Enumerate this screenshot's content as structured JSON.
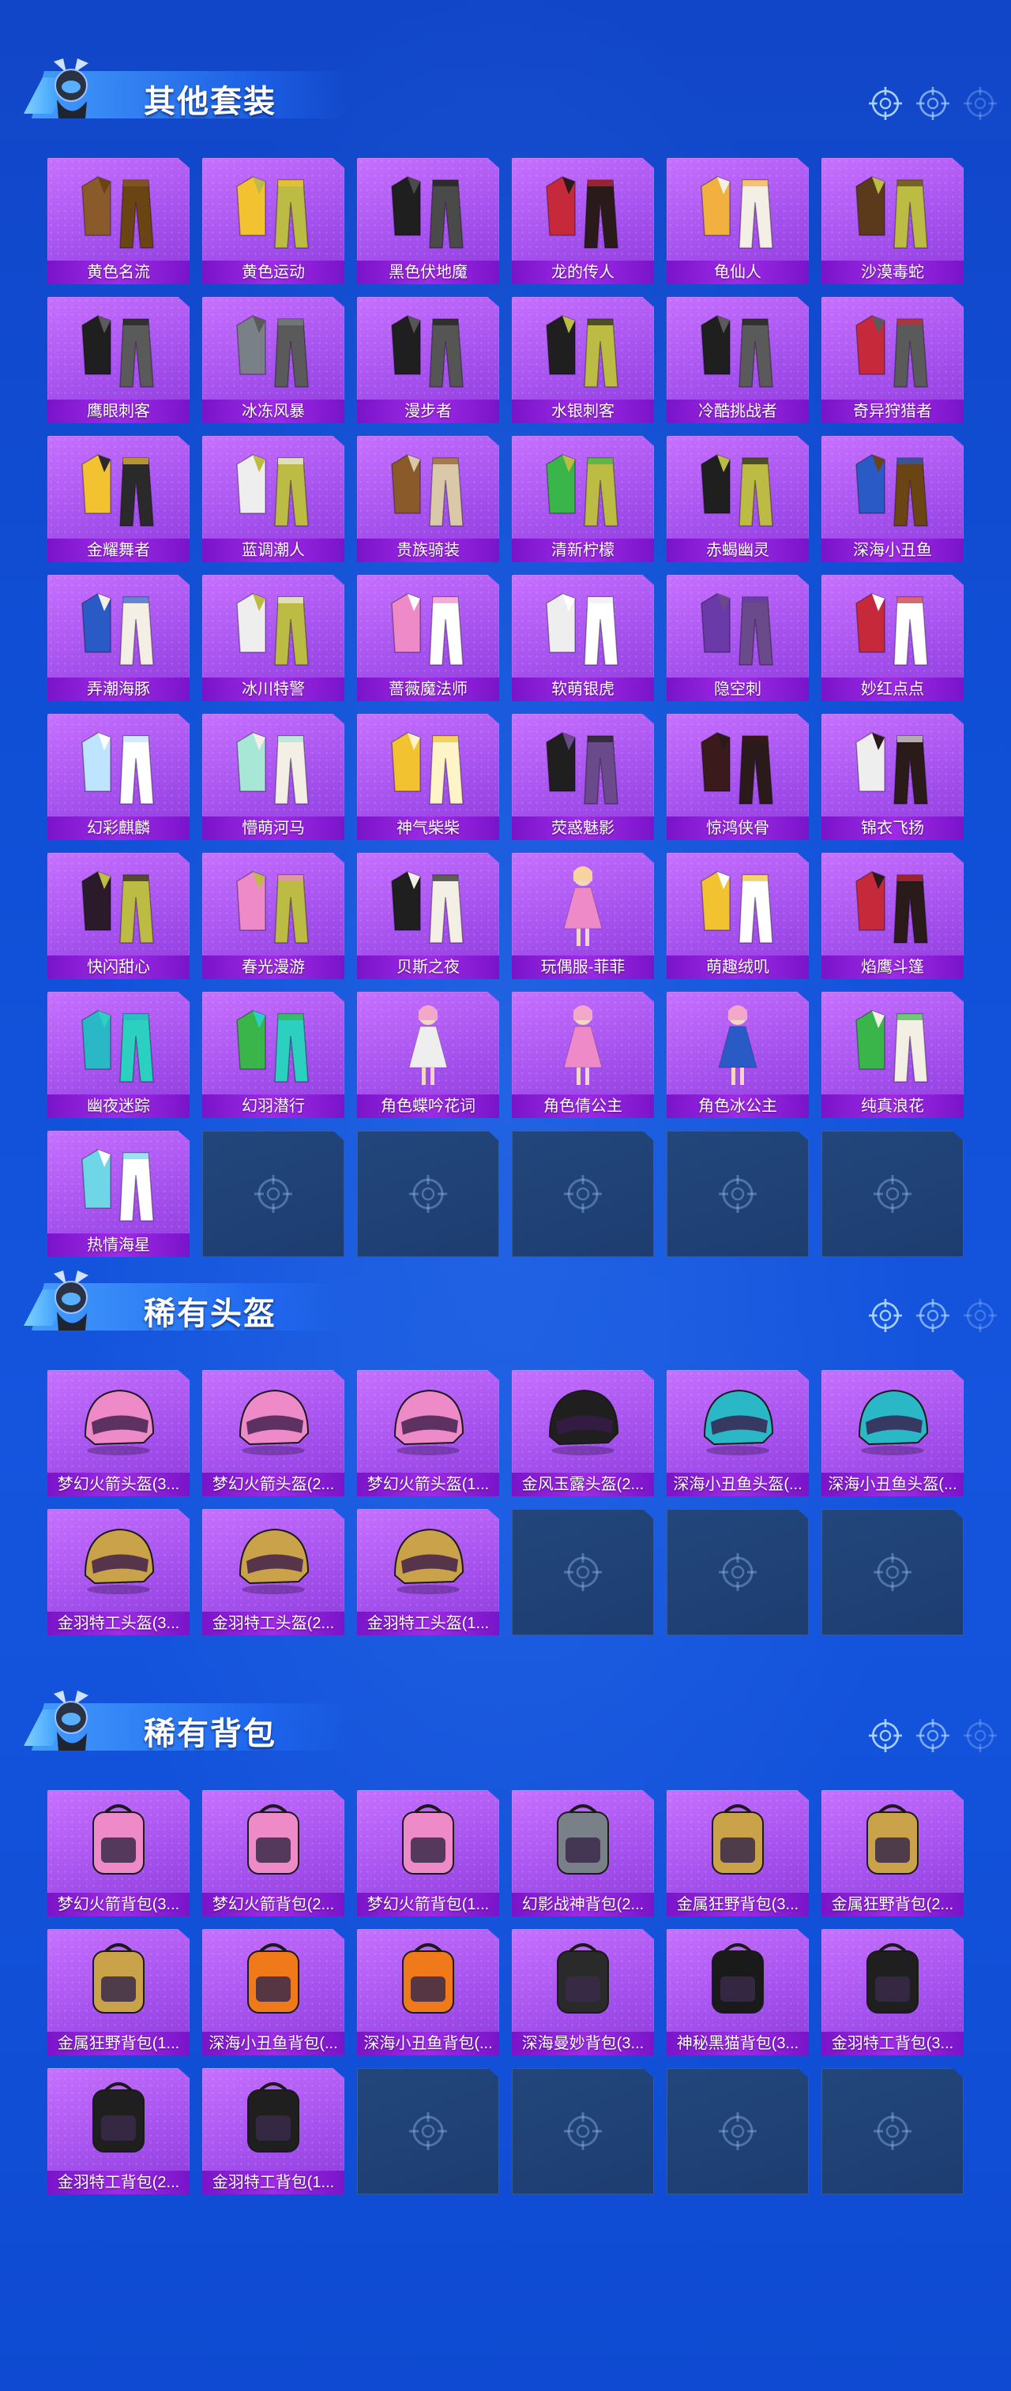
{
  "sections": [
    {
      "title": "其他套装",
      "items": [
        {
          "label": "黄色名流",
          "art": "suit-brown"
        },
        {
          "label": "黄色运动",
          "art": "jacket-yellow"
        },
        {
          "label": "黑色伏地魔",
          "art": "hoodie-black"
        },
        {
          "label": "龙的传人",
          "art": "robe-red"
        },
        {
          "label": "龟仙人",
          "art": "shirt-hawaii"
        },
        {
          "label": "沙漠毒蛇",
          "art": "jacket-leather"
        },
        {
          "label": "鹰眼刺客",
          "art": "hood-black"
        },
        {
          "label": "冰冻风暴",
          "art": "hood-grey"
        },
        {
          "label": "漫步者",
          "art": "coat-black"
        },
        {
          "label": "水银刺客",
          "art": "jacket-black"
        },
        {
          "label": "冷酷挑战者",
          "art": "hood-black"
        },
        {
          "label": "奇异狩猎者",
          "art": "hood-red"
        },
        {
          "label": "金耀舞者",
          "art": "puffer-yellow"
        },
        {
          "label": "蓝调潮人",
          "art": "jacket-white"
        },
        {
          "label": "贵族骑装",
          "art": "vest-brown"
        },
        {
          "label": "清新柠檬",
          "art": "jacket-green"
        },
        {
          "label": "赤蝎幽灵",
          "art": "jacket-black"
        },
        {
          "label": "深海小丑鱼",
          "art": "suit-blue"
        },
        {
          "label": "弄潮海豚",
          "art": "shirt-blue"
        },
        {
          "label": "冰川特警",
          "art": "jacket-white"
        },
        {
          "label": "蔷薇魔法师",
          "art": "dress-pink"
        },
        {
          "label": "软萌银虎",
          "art": "dress-white"
        },
        {
          "label": "隐空刺",
          "art": "armor-purple"
        },
        {
          "label": "妙红点点",
          "art": "dress-red"
        },
        {
          "label": "幻彩麒麟",
          "art": "dress-pastel"
        },
        {
          "label": "懵萌河马",
          "art": "shirt-mint"
        },
        {
          "label": "神气柴柴",
          "art": "top-yellow"
        },
        {
          "label": "荧惑魅影",
          "art": "armor-black"
        },
        {
          "label": "惊鸿侠骨",
          "art": "robe-dark"
        },
        {
          "label": "锦衣飞扬",
          "art": "robe-white"
        },
        {
          "label": "快闪甜心",
          "art": "jacket-heart"
        },
        {
          "label": "春光漫游",
          "art": "jacket-pink"
        },
        {
          "label": "贝斯之夜",
          "art": "shirt-black"
        },
        {
          "label": "玩偶服-菲菲",
          "art": "doll-pink"
        },
        {
          "label": "萌趣绒叽",
          "art": "dress-yellow"
        },
        {
          "label": "焰鹰斗篷",
          "art": "cloak-red"
        },
        {
          "label": "幽夜迷踪",
          "art": "ninja-teal"
        },
        {
          "label": "幻羽潜行",
          "art": "ninja-green"
        },
        {
          "label": "角色蝶吟花词",
          "art": "girl-white"
        },
        {
          "label": "角色倩公主",
          "art": "girl-pink"
        },
        {
          "label": "角色冰公主",
          "art": "girl-blue"
        },
        {
          "label": "纯真浪花",
          "art": "shirt-green"
        },
        {
          "label": "热情海星",
          "art": "dress-aqua"
        }
      ],
      "empty_count": 5
    },
    {
      "title": "稀有头盔",
      "items": [
        {
          "label": "梦幻火箭头盔(3...",
          "art": "helmet-pink"
        },
        {
          "label": "梦幻火箭头盔(2...",
          "art": "helmet-pink"
        },
        {
          "label": "梦幻火箭头盔(1...",
          "art": "helmet-pink"
        },
        {
          "label": "金风玉露头盔(2...",
          "art": "helmet-black"
        },
        {
          "label": "深海小丑鱼头盔(...",
          "art": "helmet-teal"
        },
        {
          "label": "深海小丑鱼头盔(...",
          "art": "helmet-teal"
        },
        {
          "label": "金羽特工头盔(3...",
          "art": "helmet-gold"
        },
        {
          "label": "金羽特工头盔(2...",
          "art": "helmet-gold"
        },
        {
          "label": "金羽特工头盔(1...",
          "art": "helmet-gold"
        }
      ],
      "empty_count": 3
    },
    {
      "title": "稀有背包",
      "items": [
        {
          "label": "梦幻火箭背包(3...",
          "art": "bag-pink"
        },
        {
          "label": "梦幻火箭背包(2...",
          "art": "bag-pink"
        },
        {
          "label": "梦幻火箭背包(1...",
          "art": "bag-pink"
        },
        {
          "label": "幻影战神背包(2...",
          "art": "bag-grey"
        },
        {
          "label": "金属狂野背包(3...",
          "art": "bag-gold"
        },
        {
          "label": "金属狂野背包(2...",
          "art": "bag-gold"
        },
        {
          "label": "金属狂野背包(1...",
          "art": "bag-gold"
        },
        {
          "label": "深海小丑鱼背包(...",
          "art": "bag-fish"
        },
        {
          "label": "深海小丑鱼背包(...",
          "art": "bag-fish"
        },
        {
          "label": "深海曼妙背包(3...",
          "art": "bag-tank"
        },
        {
          "label": "神秘黑猫背包(3...",
          "art": "bag-cat"
        },
        {
          "label": "金羽特工背包(3...",
          "art": "bag-black"
        },
        {
          "label": "金羽特工背包(2...",
          "art": "bag-black"
        },
        {
          "label": "金羽特工背包(1...",
          "art": "bag-black"
        }
      ],
      "empty_count": 4
    }
  ],
  "colors": {
    "tile": "#a652ee",
    "tile_label_bg": "#8a1fd6",
    "empty_tile": "#22467c",
    "background": "#1246c8",
    "header_accent": "#46a0ff"
  }
}
